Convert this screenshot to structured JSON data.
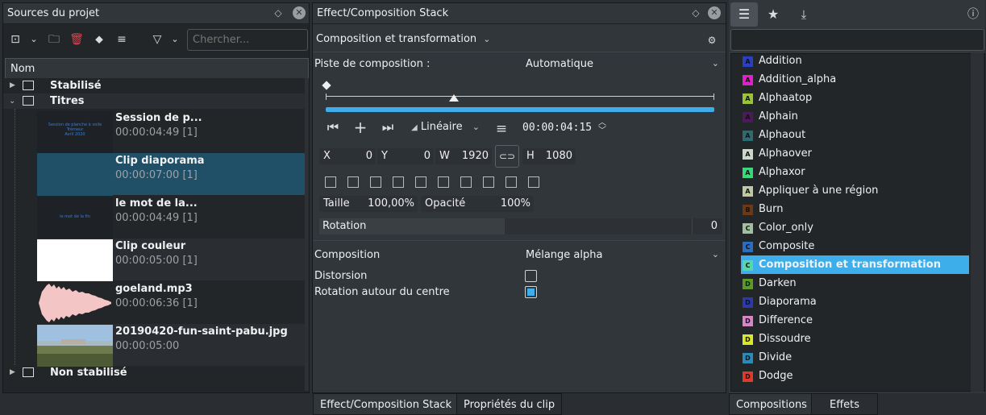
{
  "sources_panel": {
    "title": "Sources du projet",
    "search_placeholder": "Chercher...",
    "column_header": "Nom",
    "folders": {
      "stabilise": "Stabilisé",
      "titres": "Titres",
      "non_stabilise": "Non stabilisé"
    },
    "clips": [
      {
        "name": "Session de p...",
        "duration": "00:00:04:49 [1]"
      },
      {
        "name": "Clip diaporama",
        "duration": "00:00:07:00 [1]"
      },
      {
        "name": "le mot de la...",
        "duration": "00:00:04:49 [1]"
      },
      {
        "name": "Clip couleur",
        "duration": "00:00:05:00 [1]"
      },
      {
        "name": "goeland.mp3",
        "duration": "00:00:06:36 [1]"
      },
      {
        "name": "20190420-fun-saint-pabu.jpg",
        "duration": "00:00:05:00"
      }
    ],
    "thumb_texts": {
      "session": "Session de planche à voile\nTrémeur\nAvril 2020",
      "mot": "le mot de la fin"
    }
  },
  "effect_panel": {
    "title": "Effect/Composition Stack",
    "effect_name": "Composition et transformation",
    "track_label": "Piste de composition :",
    "track_value": "Automatique",
    "interp": "Linéaire",
    "timecode": "00:00:04:15",
    "x_label": "X",
    "x_value": "0",
    "y_label": "Y",
    "y_value": "0",
    "w_label": "W",
    "w_value": "1920",
    "h_label": "H",
    "h_value": "1080",
    "size_label": "Taille",
    "size_value": "100,00%",
    "opacity_label": "Opacité",
    "opacity_value": "100%",
    "rotation_label": "Rotation",
    "rotation_value": "0",
    "composition_label": "Composition",
    "composition_value": "Mélange alpha",
    "distortion_label": "Distorsion",
    "distortion_checked": false,
    "rotate_center_label": "Rotation autour du centre",
    "rotate_center_checked": true,
    "accent": "#3daee9"
  },
  "effects_list": {
    "items": [
      {
        "label": "Addition",
        "badge": "A",
        "color": "#2a3fc1"
      },
      {
        "label": "Addition_alpha",
        "badge": "A",
        "color": "#e020c8"
      },
      {
        "label": "Alphaatop",
        "badge": "A",
        "color": "#9cc23a"
      },
      {
        "label": "Alphain",
        "badge": "A",
        "color": "#4a1a5a"
      },
      {
        "label": "Alphaout",
        "badge": "A",
        "color": "#2e6b6e"
      },
      {
        "label": "Alphaover",
        "badge": "A",
        "color": "#c9d9c5"
      },
      {
        "label": "Alphaxor",
        "badge": "A",
        "color": "#3ad87a"
      },
      {
        "label": "Appliquer à une région",
        "badge": "A",
        "color": "#bfc8a0"
      },
      {
        "label": "Burn",
        "badge": "B",
        "color": "#6b3a14"
      },
      {
        "label": "Color_only",
        "badge": "C",
        "color": "#9fbf9f"
      },
      {
        "label": "Composite",
        "badge": "C",
        "color": "#2a6ec0"
      },
      {
        "label": "Composition et transformation",
        "badge": "C",
        "color": "#58d6a8",
        "selected": true
      },
      {
        "label": "Darken",
        "badge": "D",
        "color": "#5a9a2a"
      },
      {
        "label": "Diaporama",
        "badge": "D",
        "color": "#2a3aa8"
      },
      {
        "label": "Difference",
        "badge": "D",
        "color": "#d884c8"
      },
      {
        "label": "Dissoudre",
        "badge": "D",
        "color": "#d8e82a"
      },
      {
        "label": "Divide",
        "badge": "D",
        "color": "#2a8ab8"
      },
      {
        "label": "Dodge",
        "badge": "D",
        "color": "#e03a2a"
      }
    ]
  },
  "tabs": {
    "stack": "Effect/Composition Stack",
    "clip_props": "Propriétés du clip",
    "compositions": "Compositions",
    "effets": "Effets"
  }
}
